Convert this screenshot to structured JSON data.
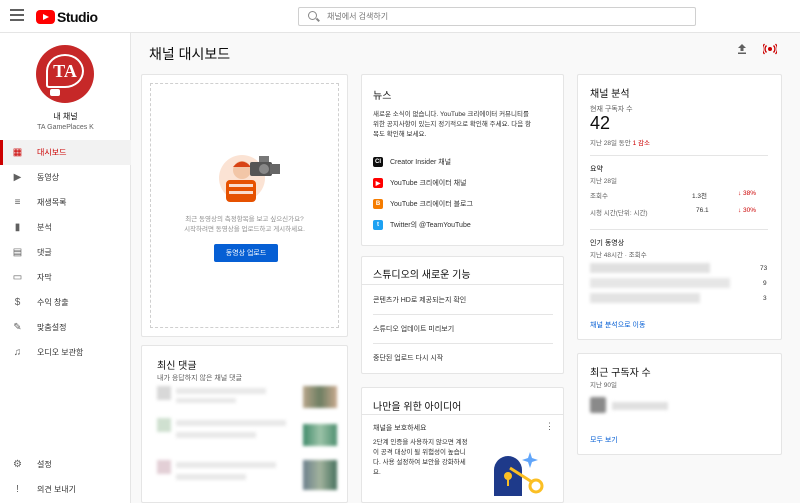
{
  "app": {
    "name": "Studio"
  },
  "search": {
    "placeholder": "채널에서 검색하기"
  },
  "sidebar": {
    "avatar_text": "TA",
    "channel_title": "내 채널",
    "channel_name": "TA GamePlaces K",
    "items": [
      {
        "label": "대시보드",
        "icon": "dashboard-icon",
        "glyph": "▦"
      },
      {
        "label": "동영상",
        "icon": "video-icon",
        "glyph": "▶"
      },
      {
        "label": "재생목록",
        "icon": "playlist-icon",
        "glyph": "≡"
      },
      {
        "label": "분석",
        "icon": "analytics-icon",
        "glyph": "▮"
      },
      {
        "label": "댓글",
        "icon": "comments-icon",
        "glyph": "▤"
      },
      {
        "label": "자막",
        "icon": "subtitles-icon",
        "glyph": "▭"
      },
      {
        "label": "수익 창출",
        "icon": "dollar-icon",
        "glyph": "$"
      },
      {
        "label": "맞춤설정",
        "icon": "customization-icon",
        "glyph": "✎"
      },
      {
        "label": "오디오 보관함",
        "icon": "audio-library-icon",
        "glyph": "♫"
      }
    ],
    "bottom": [
      {
        "label": "설정",
        "icon": "settings-icon",
        "glyph": "⚙"
      },
      {
        "label": "의견 보내기",
        "icon": "feedback-icon",
        "glyph": "!"
      }
    ]
  },
  "main": {
    "title": "채널 대시보드"
  },
  "upload_card": {
    "text_line1": "최근 동영상의 측정항목을 보고 싶으신가요?",
    "text_line2": "시작하려면 동영상을 업로드하고 게시하세요.",
    "button": "동영상 업로드"
  },
  "news": {
    "title": "뉴스",
    "body": [
      "새로운 소식이 없습니다. YouTube 크리에이터 커뮤니티를",
      "위한 공지사항이 있는지 정기적으로 확인해 주세요. 다음 항",
      "목도 확인해 보세요."
    ],
    "links": [
      {
        "label": "Creator Insider 채널",
        "badge": "CI",
        "color": "#0d0d0d"
      },
      {
        "label": "YouTube 크리에이터 채널",
        "badge": "▶",
        "color": "#ff0000"
      },
      {
        "label": "YouTube 크리에이터 블로그",
        "badge": "B",
        "color": "#f57c00"
      },
      {
        "label": "Twitter의 @TeamYouTube",
        "badge": "t",
        "color": "#1da1f2"
      }
    ]
  },
  "studio_news": {
    "title": "스튜디오의 새로운 기능",
    "items": [
      "콘텐츠가 HD로 제공되는지 확인",
      "스튜디오 업데이트 미리보기",
      "중단된 업로드 다시 시작"
    ]
  },
  "ideas": {
    "title": "나만을 위한 아이디어",
    "subtitle": "채널을 보호하세요",
    "body": [
      "2단계 인증을 사용하지 않으면 계정",
      "이 공격 대상이 될 위험성이 높습니",
      "다. 사용 설정하여 보안을 강화하세",
      "요."
    ]
  },
  "comments": {
    "title": "최신 댓글",
    "subtitle": "내가 응답하지 않은 채널 댓글"
  },
  "analytics": {
    "title": "채널 분석",
    "subs_label": "현재 구독자 수",
    "subs_value": "42",
    "subs_change_prefix": "지난 28일 동안",
    "subs_change": "1 감소",
    "summary_title": "요약",
    "summary_period": "지난 28일",
    "metrics": [
      {
        "label": "조회수",
        "value": "1.3천",
        "change": "↓ 38%"
      },
      {
        "label": "시청 시간(단위: 시간)",
        "value": "76.1",
        "change": "↓ 30%"
      }
    ],
    "top_title": "인기 동영상",
    "top_period": "지난 48시간 · 조회수",
    "top_values": [
      "73",
      "9",
      "3"
    ],
    "link": "채널 분석으로 이동"
  },
  "recent_subs": {
    "title": "최근 구독자 수",
    "period": "지난 90일",
    "link": "모두 보기"
  },
  "colors": {
    "accent": "#cc0000",
    "link": "#065fd4",
    "brand": "#ff0000"
  }
}
